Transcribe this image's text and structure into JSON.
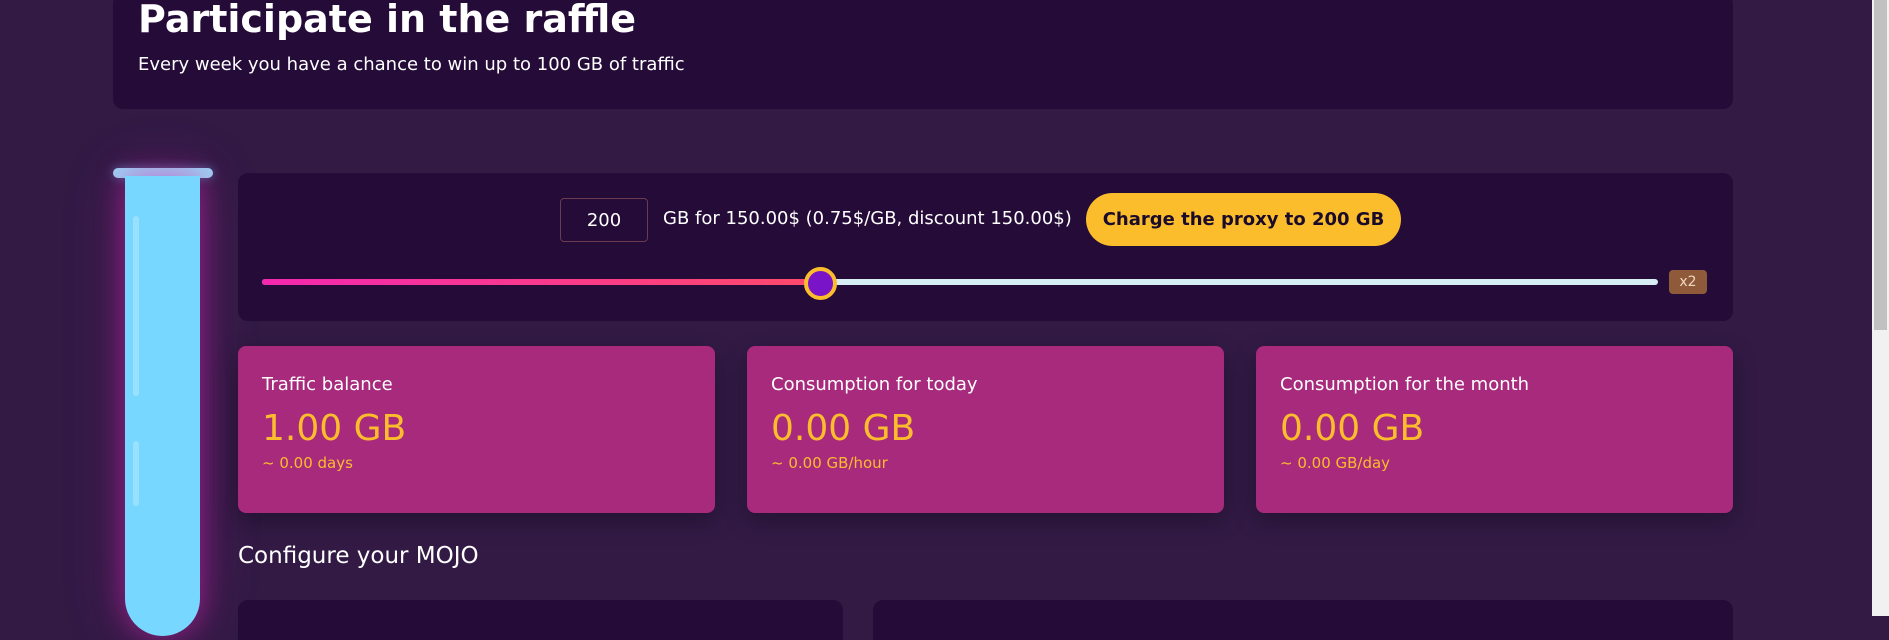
{
  "raffle": {
    "title": "Participate in the raffle",
    "subtitle": "Every week you have a chance to win up to 100 GB of traffic"
  },
  "charge": {
    "gb_value": "200",
    "price_text": "GB for 150.00$ (0.75$/GB, discount 150.00$)",
    "button_label": "Charge the proxy to 200 GB",
    "slider_fraction": 0.4,
    "multiplier": "x2"
  },
  "stats": [
    {
      "label": "Traffic balance",
      "value": "1.00 GB",
      "rate": "~ 0.00 days"
    },
    {
      "label": "Consumption for today",
      "value": "0.00 GB",
      "rate": "~ 0.00 GB/hour"
    },
    {
      "label": "Consumption for the month",
      "value": "0.00 GB",
      "rate": "~ 0.00 GB/day"
    }
  ],
  "configure": {
    "heading": "Configure your MOJO"
  },
  "colors": {
    "background": "#321a45",
    "panel": "#240b38",
    "accent": "#fbbd2c",
    "card": "#a72a7c",
    "tube": "#78d7ff"
  }
}
